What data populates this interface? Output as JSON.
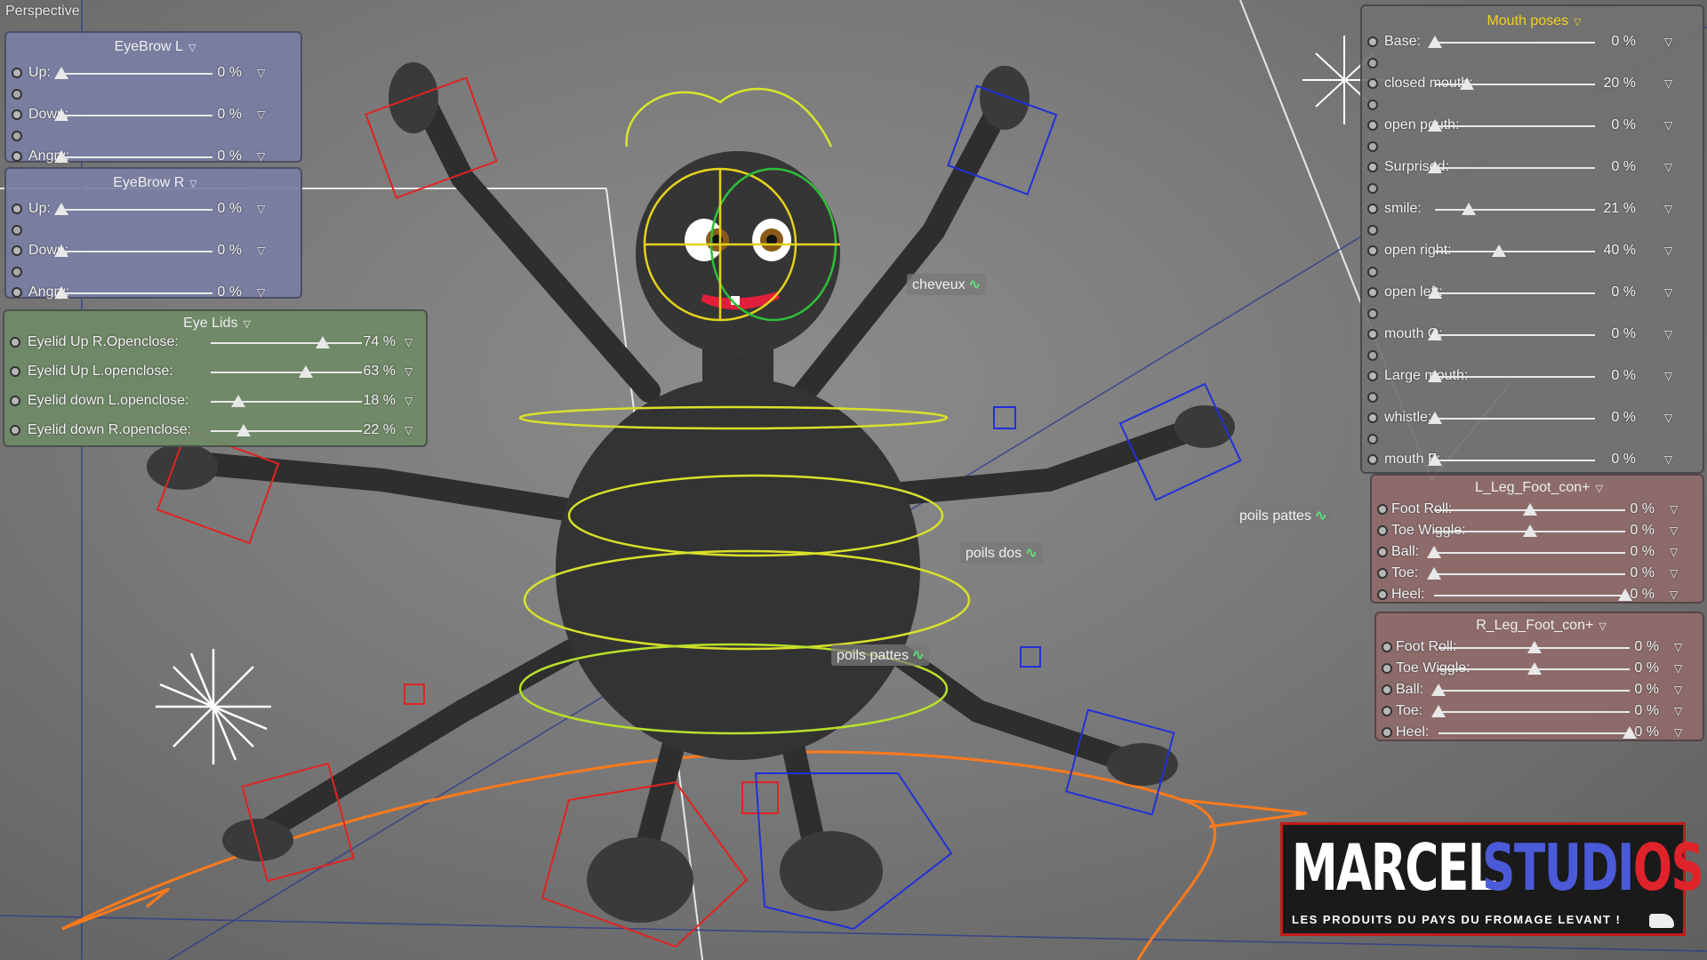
{
  "viewport": {
    "label": "Perspective"
  },
  "eyebrow_l": {
    "title": "EyeBrow L",
    "rows": [
      {
        "label": "Up:",
        "value": "0 %",
        "fraction": 0.0
      },
      {
        "label": "Down:",
        "value": "0 %",
        "fraction": 0.0
      },
      {
        "label": "Angry:",
        "value": "0 %",
        "fraction": 0.0
      }
    ]
  },
  "eyebrow_r": {
    "title": "EyeBrow R",
    "rows": [
      {
        "label": "Up:",
        "value": "0 %",
        "fraction": 0.0
      },
      {
        "label": "Down:",
        "value": "0 %",
        "fraction": 0.0
      },
      {
        "label": "Angry:",
        "value": "0 %",
        "fraction": 0.0
      }
    ]
  },
  "eye_lids": {
    "title": "Eye Lids",
    "rows": [
      {
        "label": "Eyelid Up R.Openclose:",
        "value": "74 %",
        "fraction": 0.74
      },
      {
        "label": "Eyelid Up L.openclose:",
        "value": "63 %",
        "fraction": 0.63
      },
      {
        "label": "Eyelid down L.openclose:",
        "value": "18 %",
        "fraction": 0.18
      },
      {
        "label": "Eyelid down R.openclose:",
        "value": "22 %",
        "fraction": 0.22
      }
    ]
  },
  "mouth_poses": {
    "title": "Mouth poses",
    "rows": [
      {
        "label": "Base:",
        "value": "0 %",
        "fraction": 0.0
      },
      {
        "label": "closed mouth:",
        "value": "20 %",
        "fraction": 0.2
      },
      {
        "label": "open pouth:",
        "value": "0 %",
        "fraction": 0.0
      },
      {
        "label": "Surprised:",
        "value": "0 %",
        "fraction": 0.0
      },
      {
        "label": "smile:",
        "value": "21 %",
        "fraction": 0.21
      },
      {
        "label": "open right:",
        "value": "40 %",
        "fraction": 0.4
      },
      {
        "label": "open left:",
        "value": "0 %",
        "fraction": 0.0
      },
      {
        "label": "mouth O:",
        "value": "0 %",
        "fraction": 0.0
      },
      {
        "label": "Large mouth:",
        "value": "0 %",
        "fraction": 0.0
      },
      {
        "label": "whistle:",
        "value": "0 %",
        "fraction": 0.0
      },
      {
        "label": "mouth F:",
        "value": "0 %",
        "fraction": 0.0
      }
    ]
  },
  "l_leg": {
    "title": "L_Leg_Foot_con+",
    "rows": [
      {
        "label": "Foot Roll:",
        "value": "0 %",
        "fraction": 0.5
      },
      {
        "label": "Toe Wiggle:",
        "value": "0 %",
        "fraction": 0.5
      },
      {
        "label": "Ball:",
        "value": "0 %",
        "fraction": 0.0
      },
      {
        "label": "Toe:",
        "value": "0 %",
        "fraction": 0.0
      },
      {
        "label": "Heel:",
        "value": "0 %",
        "fraction": 1.0
      }
    ]
  },
  "r_leg": {
    "title": "R_Leg_Foot_con+",
    "rows": [
      {
        "label": "Foot Roll:",
        "value": "0 %",
        "fraction": 0.5
      },
      {
        "label": "Toe Wiggle:",
        "value": "0 %",
        "fraction": 0.5
      },
      {
        "label": "Ball:",
        "value": "0 %",
        "fraction": 0.0
      },
      {
        "label": "Toe:",
        "value": "0 %",
        "fraction": 0.0
      },
      {
        "label": "Heel:",
        "value": "0 %",
        "fraction": 1.0
      }
    ]
  },
  "scene_tags": {
    "cheveux": "cheveux",
    "poils_pattes_right": "poils pattes",
    "poils_dos": "poils dos",
    "poils_pattes_center": "poils pattes"
  },
  "logo": {
    "word1": "MARCEL",
    "word2_main": "STUDI",
    "word2_accent": "OS",
    "tagline": "LES PRODUITS DU PAYS DU FROMAGE LEVANT !"
  },
  "colors": {
    "panel_blue": "#7a7ea3",
    "panel_green": "#6f8a66",
    "panel_gray": "#727272",
    "panel_red": "#8f6a6a",
    "mouth_title": "#f2d21a",
    "spider": "#2e2e2e"
  }
}
